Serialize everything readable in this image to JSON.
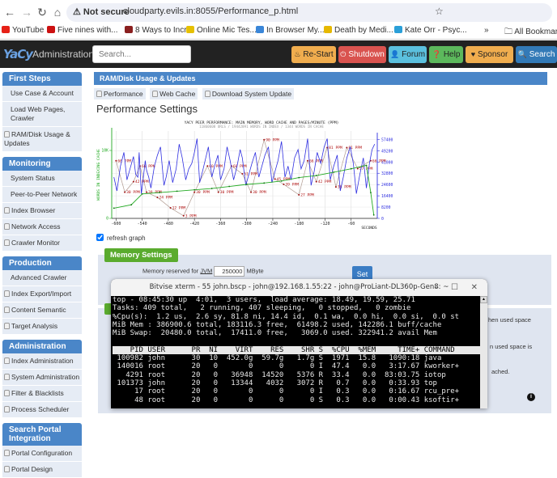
{
  "browser": {
    "security_label": "Not secure",
    "url": "cloudparty.evils.in:8055/Performance_p.html",
    "bookmarks": [
      {
        "label": "YouTube",
        "color": "#e62117"
      },
      {
        "label": "Five nines with...",
        "color": "#cc1111"
      },
      {
        "label": "8 Ways to Incr...",
        "color": "#8a1f1f"
      },
      {
        "label": "Online Mic Tes...",
        "color": "#e6c000"
      },
      {
        "label": "In Browser My...",
        "color": "#3a86d8"
      },
      {
        "label": "Death by Medi...",
        "color": "#e6b800"
      },
      {
        "label": "Kate Orr - Psyc...",
        "color": "#2a9fd8"
      }
    ],
    "more_bookmarks": "»",
    "all_bookmarks": "All Bookmarks"
  },
  "navbar": {
    "logo": "YaCy",
    "title": "Administration",
    "search_placeholder": "Search...",
    "buttons": [
      {
        "label": "Re-Start",
        "icon": "restart-icon",
        "glyph": "♨",
        "color": "#f0ad4e"
      },
      {
        "label": "Shutdown",
        "icon": "power-icon",
        "glyph": "⏻",
        "color": "#d9534f"
      },
      {
        "label": "Forum",
        "icon": "user-icon",
        "glyph": "👤",
        "color": "#5bc0de"
      },
      {
        "label": "Help",
        "icon": "help-icon",
        "glyph": "❓",
        "color": "#5cb85c"
      },
      {
        "label": "Sponsor",
        "icon": "heart-icon",
        "glyph": "♥",
        "color": "#f0ad4e"
      },
      {
        "label": "Search",
        "icon": "search-icon",
        "glyph": "🔍",
        "color": "#337ab7"
      }
    ]
  },
  "sidebar": {
    "sections": [
      {
        "title": "First Steps",
        "items": [
          {
            "label": "Use Case & Account",
            "locked": false
          },
          {
            "label": "Load Web Pages, Crawler",
            "locked": false
          },
          {
            "label": "RAM/Disk Usage & Updates",
            "locked": true
          }
        ]
      },
      {
        "title": "Monitoring",
        "items": [
          {
            "label": "System Status",
            "locked": false
          },
          {
            "label": "Peer-to-Peer Network",
            "locked": false
          },
          {
            "label": "Index Browser",
            "locked": true
          },
          {
            "label": "Network Access",
            "locked": true
          },
          {
            "label": "Crawler Monitor",
            "locked": true
          }
        ]
      },
      {
        "title": "Production",
        "items": [
          {
            "label": "Advanced Crawler",
            "locked": false
          },
          {
            "label": "Index Export/Import",
            "locked": true
          },
          {
            "label": "Content Semantic",
            "locked": true
          },
          {
            "label": "Target Analysis",
            "locked": true
          }
        ]
      },
      {
        "title": "Administration",
        "items": [
          {
            "label": "Index Administration",
            "locked": true
          },
          {
            "label": "System Administration",
            "locked": true
          },
          {
            "label": "Filter & Blacklists",
            "locked": true
          },
          {
            "label": "Process Scheduler",
            "locked": true
          }
        ]
      },
      {
        "title": "Search Portal Integration",
        "items": [
          {
            "label": "Portal Configuration",
            "locked": true
          },
          {
            "label": "Portal Design",
            "locked": true
          }
        ]
      }
    ]
  },
  "main": {
    "section_title": "RAM/Disk Usage & Updates",
    "tabs": [
      {
        "label": "Performance"
      },
      {
        "label": "Web Cache"
      },
      {
        "label": "Download System Update"
      }
    ],
    "page_title": "Performance Settings",
    "refresh_label": "refresh graph",
    "refresh_checked": true,
    "memory_settings_label": "Memory Settings",
    "memory_reserved_label": "Memory reserved for ",
    "jvm_label": "JVM",
    "memory_value": "250000",
    "memory_unit": "MByte",
    "set_label": "Set",
    "partial_texts": [
      "hen used space",
      "n used space is",
      "ached."
    ]
  },
  "chart_data": {
    "type": "line",
    "title": "YACY PEER PERFORMANCE: MAIN MEMORY, WORD CACHE AND PAGES/MINUTE (PPM)",
    "subtitle": "11860608 URLS / 19442091 WORDS IN INDEX / 1344 WORDS IN CACHE",
    "xlabel": "SECONDS",
    "ylabel_left": "WORDS IN INDEXING CACHE",
    "x_ticks": [
      -600,
      -540,
      -480,
      -420,
      -360,
      -300,
      -240,
      -180,
      -120,
      -60
    ],
    "xlim": [
      -610,
      0
    ],
    "left_ticks": [
      "0",
      "10K"
    ],
    "right_ticks": [
      "0",
      "8200",
      "16400",
      "24600",
      "32800",
      "41000",
      "49200",
      "57400"
    ],
    "right_ylim": [
      0,
      60000
    ],
    "ppm_labels": [
      {
        "x": -600,
        "label": "66 PPM",
        "v": 66
      },
      {
        "x": -580,
        "label": "30 PPM",
        "v": 30
      },
      {
        "x": -560,
        "label": "42 PPM",
        "v": 42
      },
      {
        "x": -545,
        "label": "60 PPM",
        "v": 60
      },
      {
        "x": -530,
        "label": "30 PPM",
        "v": 30
      },
      {
        "x": -505,
        "label": "24 PPM",
        "v": 24
      },
      {
        "x": -475,
        "label": "12 PPM",
        "v": 12
      },
      {
        "x": -445,
        "label": "3 PPM",
        "v": 3
      },
      {
        "x": -420,
        "label": "30 PPM",
        "v": 30
      },
      {
        "x": -390,
        "label": "60 PPM",
        "v": 60
      },
      {
        "x": -365,
        "label": "30 PPM",
        "v": 30
      },
      {
        "x": -335,
        "label": "60 PPM",
        "v": 60
      },
      {
        "x": -310,
        "label": "51 PPM",
        "v": 51
      },
      {
        "x": -290,
        "label": "30 PPM",
        "v": 30
      },
      {
        "x": -260,
        "label": "90 PPM",
        "v": 90
      },
      {
        "x": -235,
        "label": "45 PPM",
        "v": 45
      },
      {
        "x": -215,
        "label": "39 PPM",
        "v": 39
      },
      {
        "x": -180,
        "label": "27 PPM",
        "v": 27
      },
      {
        "x": -160,
        "label": "66 PPM",
        "v": 66
      },
      {
        "x": -140,
        "label": "42 PPM",
        "v": 42
      },
      {
        "x": -115,
        "label": "81 PPM",
        "v": 81
      },
      {
        "x": -95,
        "label": "36 PPM",
        "v": 36
      },
      {
        "x": -70,
        "label": "81 PPM",
        "v": 81
      },
      {
        "x": -45,
        "label": "57 PPM",
        "v": 57
      },
      {
        "x": -15,
        "label": "66 PPM",
        "v": 66
      }
    ],
    "series": [
      {
        "name": "Main memory",
        "color": "#3030e0",
        "x": [
          -605,
          -598,
          -590,
          -582,
          -575,
          -568,
          -560,
          -555,
          -550,
          -547,
          -542,
          -538,
          -533,
          -530,
          -525,
          -520,
          -512,
          -505,
          -498,
          -490,
          -485,
          -478,
          -470,
          -462,
          -455,
          -448,
          -440,
          -433,
          -426,
          -420,
          -414,
          -408,
          -400,
          -394,
          -388,
          -380,
          -372,
          -366,
          -360,
          -352,
          -345,
          -338,
          -330,
          -322,
          -315,
          -310,
          -302,
          -295,
          -288,
          -280,
          -272,
          -265,
          -258,
          -250,
          -242,
          -235,
          -228,
          -220,
          -212,
          -205,
          -198,
          -190,
          -182,
          -175,
          -168,
          -160,
          -152,
          -145,
          -138,
          -130,
          -122,
          -115,
          -108,
          -100,
          -92,
          -85,
          -78,
          -70,
          -62,
          -55,
          -48,
          -40,
          -32,
          -25,
          -18,
          -12,
          -6
        ],
        "y": [
          30000,
          20000,
          38000,
          48000,
          28000,
          36000,
          45000,
          32000,
          30000,
          48000,
          18000,
          28000,
          42000,
          35000,
          30000,
          22000,
          38000,
          46000,
          52000,
          24000,
          30000,
          42000,
          26000,
          36000,
          54000,
          44000,
          28000,
          36000,
          40000,
          48000,
          58000,
          26000,
          36000,
          44000,
          52000,
          30000,
          40000,
          46000,
          28000,
          36000,
          52000,
          42000,
          28000,
          38000,
          50000,
          44000,
          24000,
          32000,
          40000,
          48000,
          30000,
          38000,
          46000,
          52000,
          26000,
          34000,
          42000,
          56000,
          30000,
          38000,
          28000,
          44000,
          50000,
          36000,
          42000,
          58000,
          24000,
          34000,
          48000,
          40000,
          52000,
          58000,
          28000,
          38000,
          46000,
          20000,
          30000,
          44000,
          52000,
          40000,
          18000,
          32000,
          44000,
          22000,
          40000,
          50000,
          54000
        ]
      },
      {
        "name": "Word cache",
        "color": "#22aa22",
        "x": [
          -605,
          -565,
          -540,
          -500,
          -460,
          -420,
          -380,
          -340,
          -300,
          -260,
          -220,
          -180,
          -140,
          -100,
          -60,
          -25,
          -15,
          -8
        ],
        "y": [
          1500,
          2000,
          3600,
          3800,
          4000,
          4200,
          4400,
          4700,
          5000,
          5200,
          5500,
          6000,
          6300,
          6800,
          7300,
          7800,
          3800,
          500
        ]
      }
    ]
  },
  "terminal": {
    "title": "Bitvise xterm - 55 john.bscp - john@192.168.1.55:22 - john@ProLiant-DL360p-Gen8: ~",
    "minimize": "–",
    "maximize": "☐",
    "close": "✕",
    "summary_lines": [
      "top - 08:45:30 up  4:01,  3 users,  load average: 18.49, 19.59, 25.71",
      "Tasks: 409 total,   2 running, 407 sleeping,   0 stopped,   0 zombie",
      "%Cpu(s):  1.2 us,  2.6 sy, 81.8 ni, 14.4 id,  0.1 wa,  0.0 hi,  0.0 si,  0.0 st",
      "MiB Mem : 386900.6 total, 183116.3 free,  61498.2 used, 142286.1 buff/cache",
      "MiB Swap:  20480.0 total,  17411.0 free,   3069.0 used. 322941.2 avail Mem",
      ""
    ],
    "header": "    PID USER      PR  NI    VIRT    RES    SHR S  %CPU  %MEM     TIME+ COMMAND",
    "processes": [
      " 100982 john      30  10  452.0g  59.7g   1.7g S  1971  15.8   1090:18 java",
      " 140016 root      20   0       0      0      0 I  47.4   0.0   3:17.67 kworker+",
      "   4291 root      20   0   36948  14520   5376 R  33.4   0.0  83:03.75 iotop",
      " 101373 john      20   0   13344   4032   3072 R   0.7   0.0   0:33.93 top",
      "     17 root      20   0       0      0      0 I   0.3   0.0   0:16.67 rcu_pre+",
      "     48 root      20   0       0      0      0 S   0.3   0.0   0:00.43 ksoftir+"
    ]
  }
}
